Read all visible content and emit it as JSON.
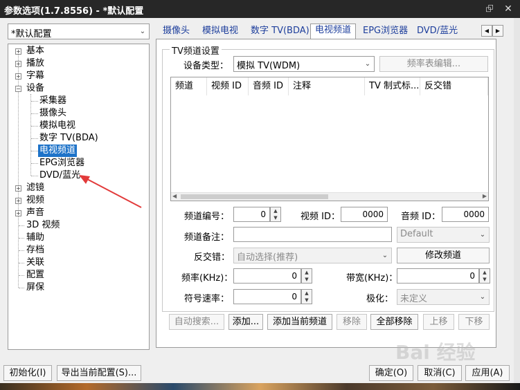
{
  "window": {
    "title": "参数选项(1.7.8556) - *默认配置",
    "pin_icon": "pin-icon",
    "close_icon": "close-icon"
  },
  "profile_select": {
    "value": "*默认配置"
  },
  "tree": {
    "items": [
      {
        "label": "基本"
      },
      {
        "label": "播放"
      },
      {
        "label": "字幕"
      },
      {
        "label": "设备"
      },
      {
        "label": "采集器"
      },
      {
        "label": "摄像头"
      },
      {
        "label": "模拟电视"
      },
      {
        "label": "数字 TV(BDA)"
      },
      {
        "label": "电视频道"
      },
      {
        "label": "EPG浏览器"
      },
      {
        "label": "DVD/蓝光"
      },
      {
        "label": "滤镜"
      },
      {
        "label": "视频"
      },
      {
        "label": "声音"
      },
      {
        "label": "3D 视频"
      },
      {
        "label": "辅助"
      },
      {
        "label": "存档"
      },
      {
        "label": "关联"
      },
      {
        "label": "配置"
      },
      {
        "label": "屏保"
      }
    ]
  },
  "tabs": [
    "摄像头",
    "模拟电视",
    "数字 TV(BDA)",
    "电视频道",
    "EPG浏览器",
    "DVD/蓝光"
  ],
  "group": {
    "title": "TV频道设置",
    "device_type_label": "设备类型：",
    "device_type_value": "模拟 TV(WDM)",
    "freq_table_button": "频率表编辑..."
  },
  "table": {
    "columns": [
      "频道",
      "视频 ID",
      "音频 ID",
      "注释",
      "TV 制式标...",
      "反交错"
    ]
  },
  "form": {
    "channel_no_label": "频道编号：",
    "channel_no_value": "0",
    "video_id_label": "视频 ID：",
    "video_id_value": "0000",
    "audio_id_label": "音频 ID：",
    "audio_id_value": "0000",
    "channel_note_label": "频道备注：",
    "channel_note_value": "",
    "default_select": "Default",
    "deinterlace_label": "反交错：",
    "deinterlace_value": "自动选择(推荐)",
    "modify_channel_button": "修改频道",
    "freq_label": "频率(KHz)：",
    "freq_value": "0",
    "bandwidth_label": "带宽(KHz)：",
    "bandwidth_value": "0",
    "symbol_rate_label": "符号速率：",
    "symbol_rate_value": "0",
    "polarization_label": "极化：",
    "polarization_value": "未定义"
  },
  "actions": [
    "自动搜索...",
    "添加...",
    "添加当前频道",
    "移除",
    "全部移除",
    "上移",
    "下移"
  ],
  "footer": {
    "init_button": "初始化(I)",
    "export_button": "导出当前配置(S)...",
    "ok_button": "确定(O)",
    "cancel_button": "取消(C)",
    "apply_button": "应用(A)"
  },
  "watermark": "Bai 经验",
  "colors": {
    "selection": "#1e73c9",
    "tab_text": "#1d3e9c",
    "annotation_arrow": "#e23a3a"
  }
}
